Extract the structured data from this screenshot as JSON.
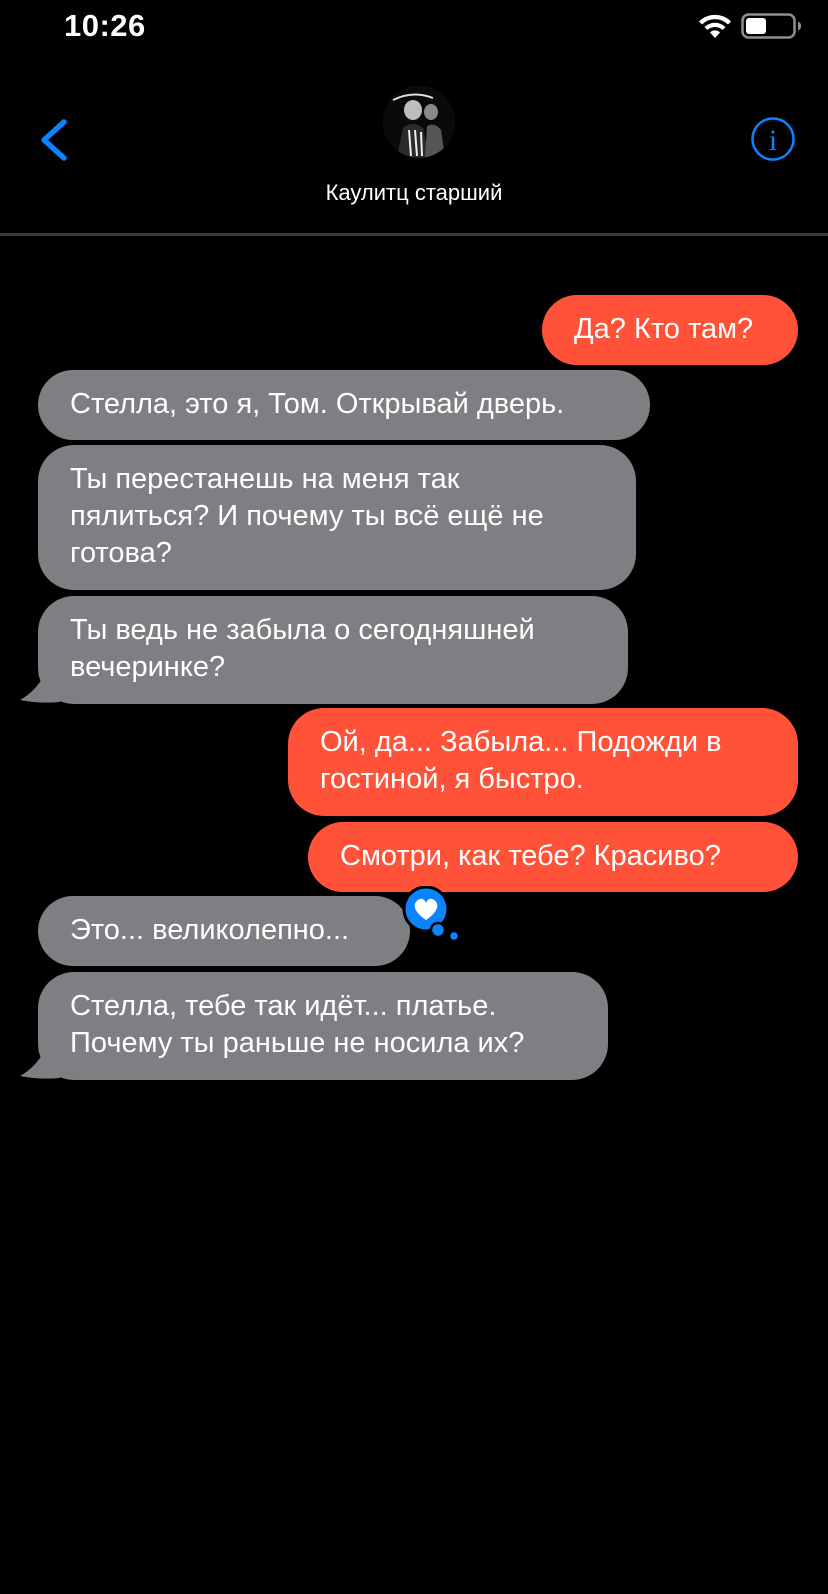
{
  "status_bar": {
    "time": "10:26",
    "icons": [
      "wifi-icon",
      "battery-icon"
    ]
  },
  "header": {
    "contact_name": "Каулитц старший",
    "back_icon": "chevron-left-icon",
    "info_icon": "info-icon"
  },
  "colors": {
    "outgoing_bubble": "#ff5239",
    "incoming_bubble": "#7f7e83",
    "accent": "#0a84ff",
    "background": "#000000"
  },
  "messages": [
    {
      "from": "me",
      "text": "Да? Кто там?"
    },
    {
      "from": "them",
      "text": "Стелла, это я, Том. Открывай дверь."
    },
    {
      "from": "them",
      "text": "Ты перестанешь на меня так пялиться? И почему ты всё ещё не готова?"
    },
    {
      "from": "them",
      "text": "Ты ведь не забыла о сегодняшней вечеринке?"
    },
    {
      "from": "me",
      "text": "Ой, да... Забыла... Подожди в гостиной, я быстро."
    },
    {
      "from": "me",
      "text": "Смотри, как тебе? Красиво?"
    },
    {
      "from": "them",
      "text": "Это... великолепно...",
      "reaction": "heart-icon"
    },
    {
      "from": "them",
      "text": "Стелла, тебе так идёт... платье. Почему ты раньше не носила их?"
    }
  ]
}
